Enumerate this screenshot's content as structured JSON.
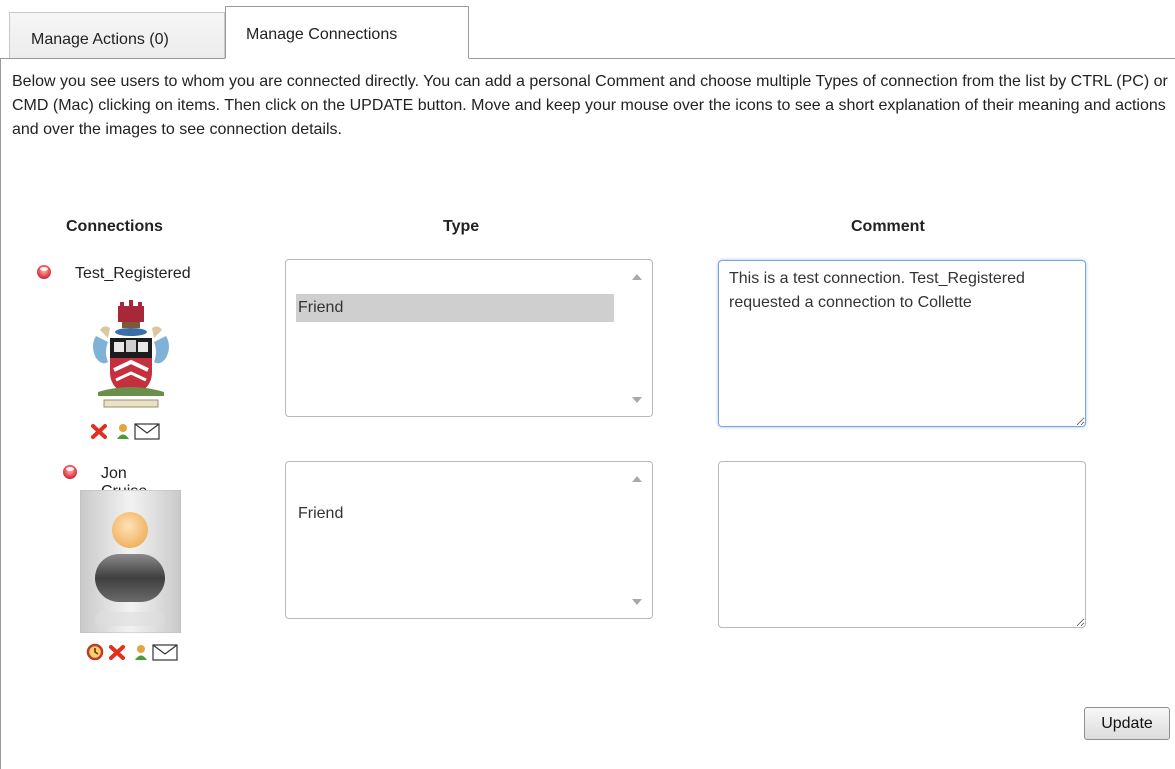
{
  "tabs": [
    {
      "label": "Manage Actions (0)"
    },
    {
      "label": "Manage Connections"
    }
  ],
  "intro_text": "Below you see users to whom you are connected directly. You can add a personal Comment and choose multiple Types of connection from the list by CTRL (PC) or CMD (Mac) clicking on items. Then click on the UPDATE button. Move and keep your mouse over the icons to see a short explanation of their meaning and actions and over the images to see connection details.",
  "columns": {
    "connections": "Connections",
    "type": "Type",
    "comment": "Comment"
  },
  "connections": [
    {
      "name": "Test_Registered",
      "status_icon": "red-status-dot-icon",
      "avatar": "coat-of-arms-image",
      "icons": [
        "delete-icon",
        "profile-icon",
        "mail-icon"
      ],
      "type_option": "Friend",
      "type_selected": true,
      "comment": "This is a test connection. Test_Registered requested a connection to Collette"
    },
    {
      "name": "Jon Cruise",
      "status_icon": "red-status-dot-icon",
      "avatar": "default-person-avatar",
      "icons": [
        "clock-icon",
        "delete-icon",
        "profile-icon",
        "mail-icon"
      ],
      "type_option": "Friend",
      "type_selected": false,
      "comment": ""
    }
  ],
  "update_label": "Update",
  "colors": {
    "tab_border": "#9a9a9a",
    "selected_option": "#cfcfcf",
    "focus_border": "#7aa7e0",
    "status_red": "#d9344b"
  }
}
